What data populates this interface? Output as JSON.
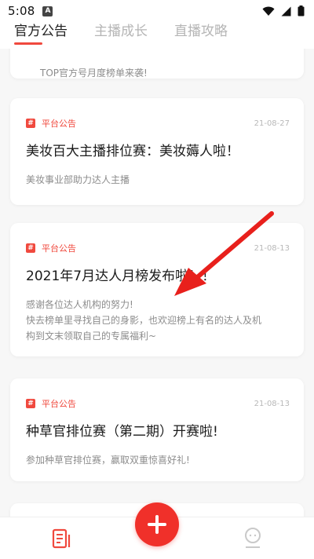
{
  "status_bar": {
    "time": "5:08",
    "notification_badge": "A",
    "icons": [
      "wifi-icon",
      "signal-icon",
      "battery-icon"
    ]
  },
  "tabs": [
    {
      "label": "官方公告",
      "active": true
    },
    {
      "label": "主播成长",
      "active": false
    },
    {
      "label": "直播攻略",
      "active": false
    }
  ],
  "feed": {
    "partial_card": {
      "description": "TOP官方号月度榜单来袭!"
    },
    "cards": [
      {
        "category": "平台公告",
        "date": "21-08-27",
        "title": "美妆百大主播排位赛：美妆薅人啦！",
        "description": "美妆事业部助力达人主播"
      },
      {
        "category": "平台公告",
        "date": "21-08-13",
        "title": "2021年7月达人月榜发布啦！！",
        "description_line1": "感谢各位达人机构的努力!",
        "description_line2": "快去榜单里寻找自己的身影，也欢迎榜上有名的达人及机",
        "description_line3": "构到文末领取自己的专属福利~"
      },
      {
        "category": "平台公告",
        "date": "21-08-13",
        "title": "种草官排位赛（第二期）开赛啦!",
        "description": "参加种草官排位赛，赢取双重惊喜好礼!"
      }
    ]
  },
  "bottom_nav": {
    "left_icon": "document-icon",
    "center_button": "add-icon",
    "right_icon": "profile-icon"
  },
  "colors": {
    "accent": "#f0493e",
    "fab": "#f0302a",
    "annotation_arrow": "#e8201c"
  }
}
